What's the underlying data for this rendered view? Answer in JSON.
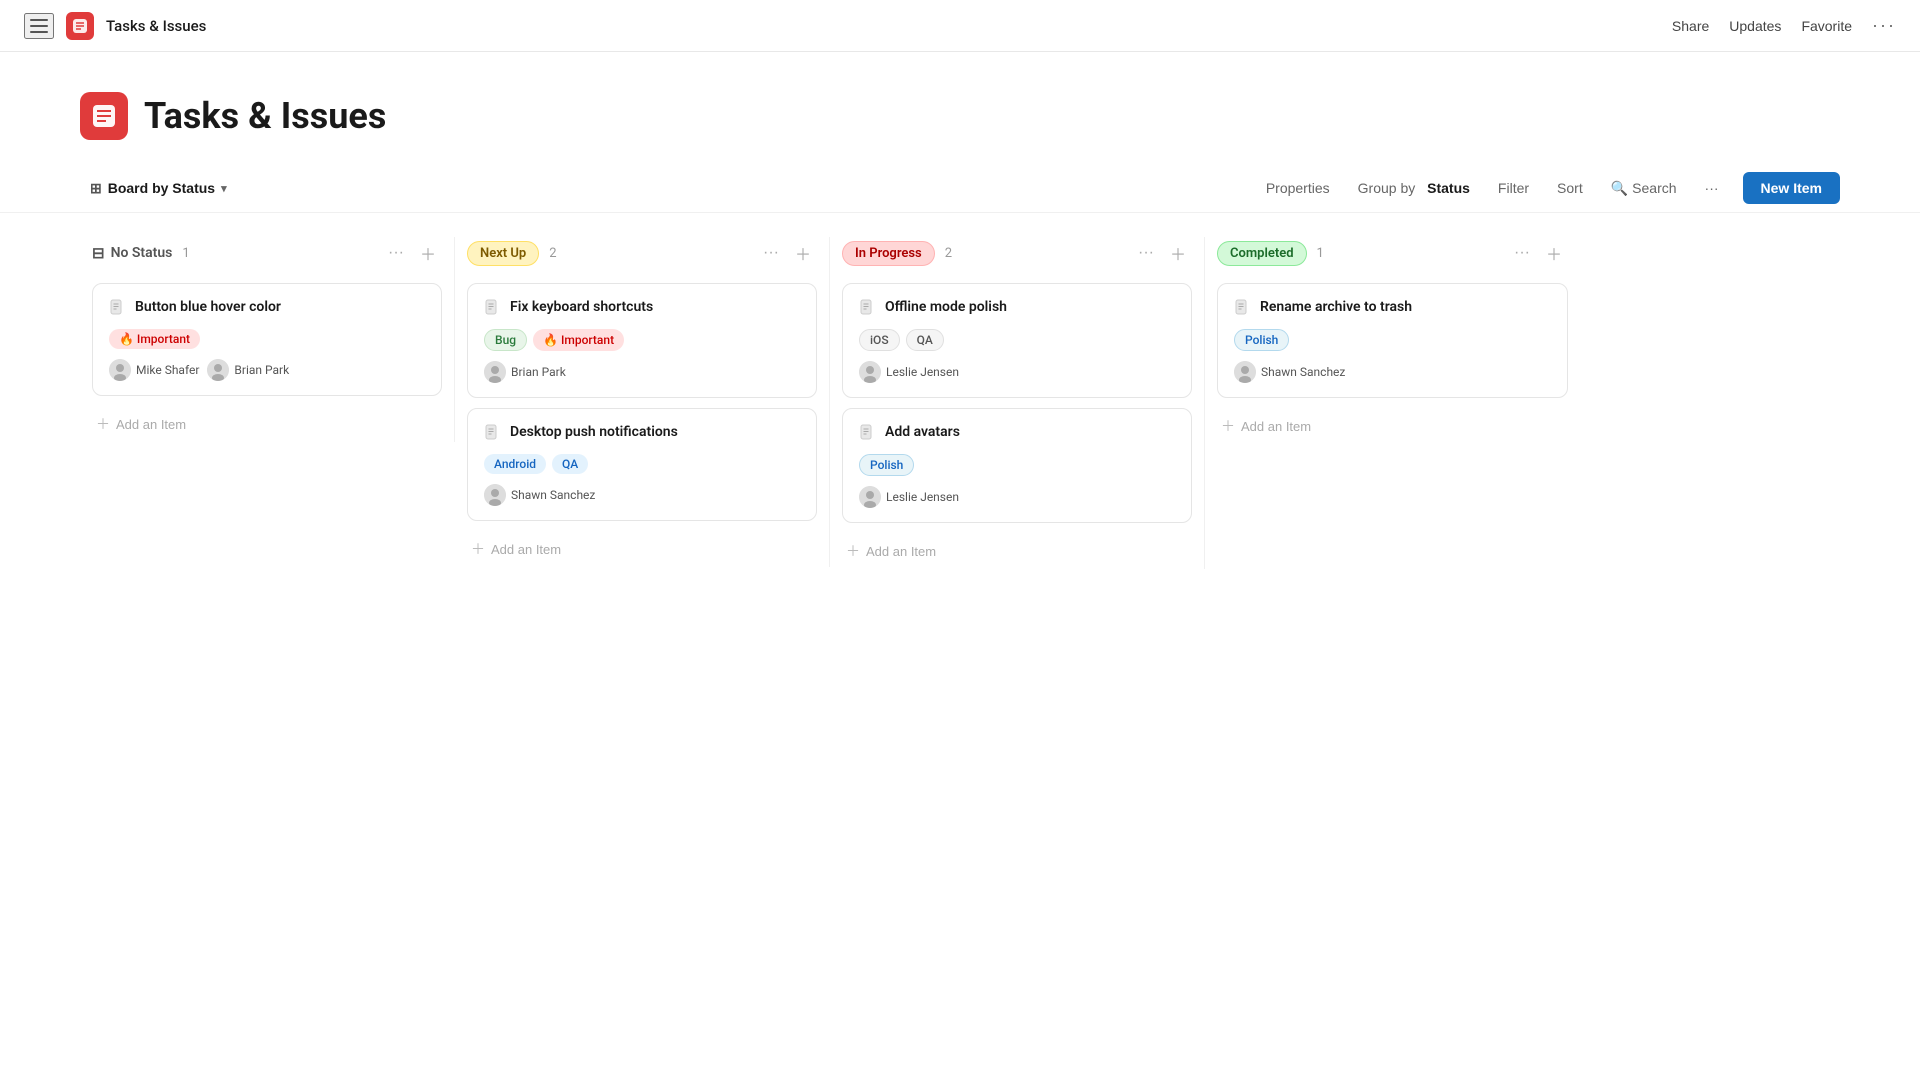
{
  "topnav": {
    "app_title": "Tasks & Issues",
    "share_label": "Share",
    "updates_label": "Updates",
    "favorite_label": "Favorite",
    "more_label": "···"
  },
  "page": {
    "title": "Tasks & Issues",
    "logo_emoji": "📋"
  },
  "toolbar": {
    "board_view_label": "Board by Status",
    "properties_label": "Properties",
    "group_by_prefix": "Group by",
    "group_by_value": "Status",
    "filter_label": "Filter",
    "sort_label": "Sort",
    "search_label": "Search",
    "more_label": "···",
    "new_item_label": "New Item"
  },
  "columns": [
    {
      "id": "no-status",
      "title": "No Status",
      "badge_type": "none",
      "count": 1,
      "cards": [
        {
          "title": "Button blue hover color",
          "tags": [
            {
              "label": "🔥 Important",
              "type": "important"
            }
          ],
          "assignees": [
            {
              "name": "Mike Shafer"
            },
            {
              "name": "Brian Park"
            }
          ]
        }
      ]
    },
    {
      "id": "next-up",
      "title": "Next Up",
      "badge_type": "next-up",
      "count": 2,
      "cards": [
        {
          "title": "Fix keyboard shortcuts",
          "tags": [
            {
              "label": "Bug",
              "type": "bug"
            },
            {
              "label": "🔥 Important",
              "type": "important"
            }
          ],
          "assignees": [
            {
              "name": "Brian Park"
            }
          ]
        },
        {
          "title": "Desktop push notifications",
          "tags": [
            {
              "label": "Android",
              "type": "android"
            },
            {
              "label": "QA",
              "type": "qa-blue"
            }
          ],
          "assignees": [
            {
              "name": "Shawn Sanchez"
            }
          ]
        }
      ]
    },
    {
      "id": "in-progress",
      "title": "In Progress",
      "badge_type": "in-progress",
      "count": 2,
      "cards": [
        {
          "title": "Offline mode polish",
          "tags": [
            {
              "label": "iOS",
              "type": "ios"
            },
            {
              "label": "QA",
              "type": "qa"
            }
          ],
          "assignees": [
            {
              "name": "Leslie Jensen"
            }
          ]
        },
        {
          "title": "Add avatars",
          "tags": [
            {
              "label": "Polish",
              "type": "polish"
            }
          ],
          "assignees": [
            {
              "name": "Leslie Jensen"
            }
          ]
        }
      ]
    },
    {
      "id": "completed",
      "title": "Completed",
      "badge_type": "completed",
      "count": 1,
      "cards": [
        {
          "title": "Rename archive to trash",
          "tags": [
            {
              "label": "Polish",
              "type": "polish"
            }
          ],
          "assignees": [
            {
              "name": "Shawn Sanchez"
            }
          ]
        }
      ]
    }
  ],
  "add_item_label": "+ Add an Item"
}
